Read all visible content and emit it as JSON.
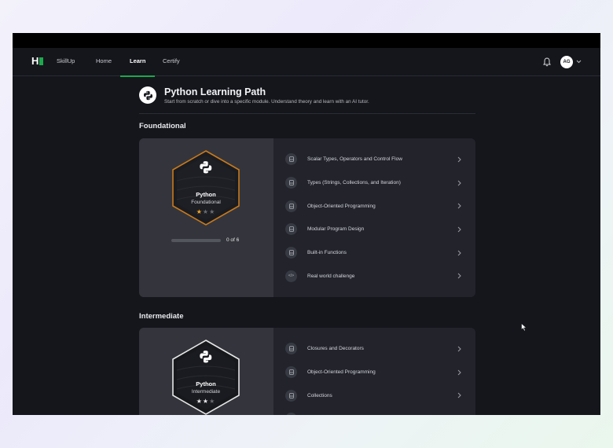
{
  "nav": {
    "brand": "SkillUp",
    "items": [
      {
        "label": "Home",
        "active": false
      },
      {
        "label": "Learn",
        "active": true
      },
      {
        "label": "Certify",
        "active": false
      }
    ],
    "avatar_initials": "AG"
  },
  "page": {
    "title": "Python Learning Path",
    "subtitle": "Start from scratch or dive into a specific module. Understand theory and learn with an AI tutor."
  },
  "sections": [
    {
      "title": "Foundational",
      "badge": {
        "name": "Python",
        "level": "Foundational",
        "stars_filled": 1,
        "stars_total": 3
      },
      "progress": {
        "text": "0 of 6",
        "value": 0
      },
      "modules": [
        {
          "label": "Scalar Types, Operators and Control Flow",
          "icon": "document-icon"
        },
        {
          "label": "Types (Strings, Collections, and Iteration)",
          "icon": "document-icon"
        },
        {
          "label": "Object-Oriented Programming",
          "icon": "document-icon"
        },
        {
          "label": "Modular Program Design",
          "icon": "document-icon"
        },
        {
          "label": "Built-in Functions",
          "icon": "document-icon"
        },
        {
          "label": "Real world challenge",
          "icon": "code-icon"
        }
      ]
    },
    {
      "title": "Intermediate",
      "badge": {
        "name": "Python",
        "level": "Intermediate",
        "stars_filled": 2,
        "stars_total": 3
      },
      "modules": [
        {
          "label": "Closures and Decorators",
          "icon": "document-icon"
        },
        {
          "label": "Object-Oriented Programming",
          "icon": "document-icon"
        },
        {
          "label": "Collections",
          "icon": "document-icon"
        },
        {
          "label": "",
          "icon": "document-icon"
        }
      ]
    }
  ],
  "colors": {
    "accent": "#1ba94c",
    "background": "#15161c",
    "card": "#22232b",
    "card_left": "#34353c",
    "star_gold": "#f5a623"
  }
}
